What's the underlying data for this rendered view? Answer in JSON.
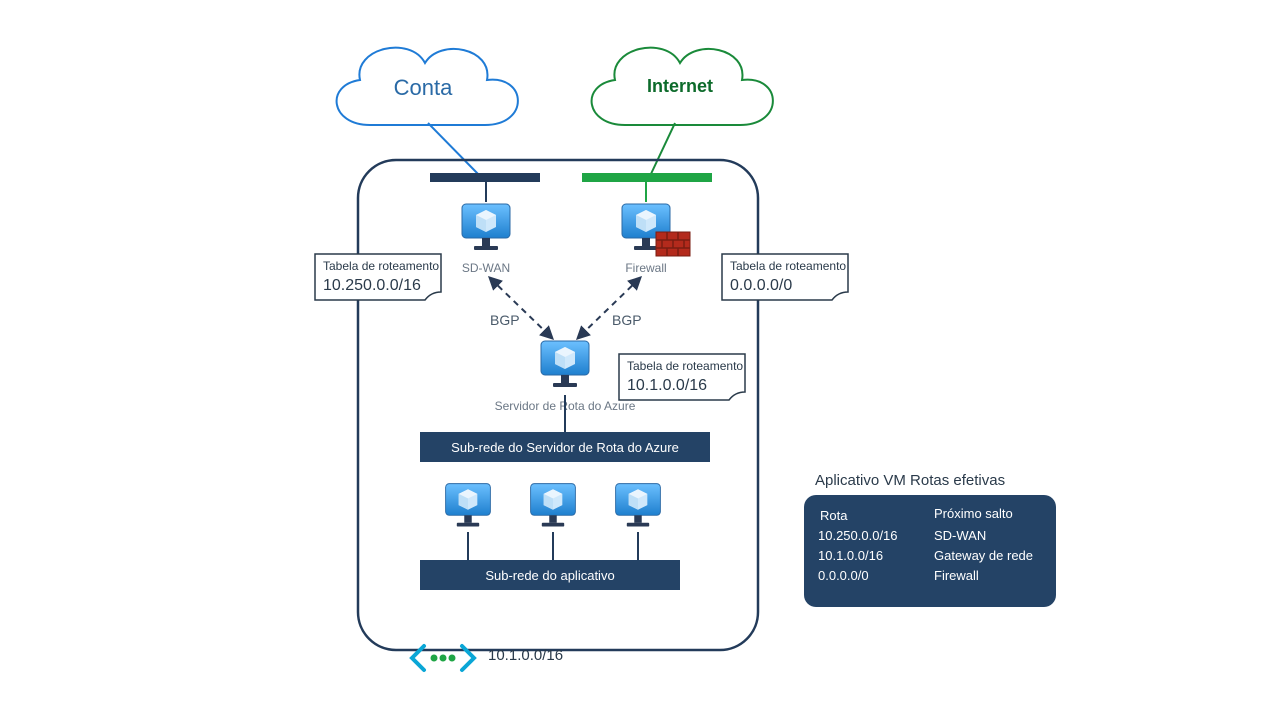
{
  "clouds": {
    "conta": "Conta",
    "internet": "Internet"
  },
  "nodes": {
    "sdwan": "SD-WAN",
    "firewall": "Firewall",
    "route_server": "Servidor de Rota do Azure",
    "bgp_left": "BGP",
    "bgp_right": "BGP"
  },
  "subnets": {
    "route_server": "Sub-rede do Servidor de Rota do Azure",
    "app": "Sub-rede do aplicativo"
  },
  "route_tables": {
    "title": "Tabela de roteamento",
    "left": "10.250.0.0/16",
    "right": "0.0.0.0/0",
    "center": "10.1.0.0/16"
  },
  "vnet_cidr": "10.1.0.0/16",
  "effective_routes": {
    "title": "Aplicativo VM Rotas efetivas",
    "headers": {
      "route": "Rota",
      "next_hop": "Próximo salto"
    },
    "rows": [
      {
        "route": "10.250.0.0/16",
        "next_hop": "SD-WAN"
      },
      {
        "route": "10.1.0.0/16",
        "next_hop": "Gateway de rede"
      },
      {
        "route": "0.0.0.0/0",
        "next_hop": "Firewall"
      }
    ]
  }
}
